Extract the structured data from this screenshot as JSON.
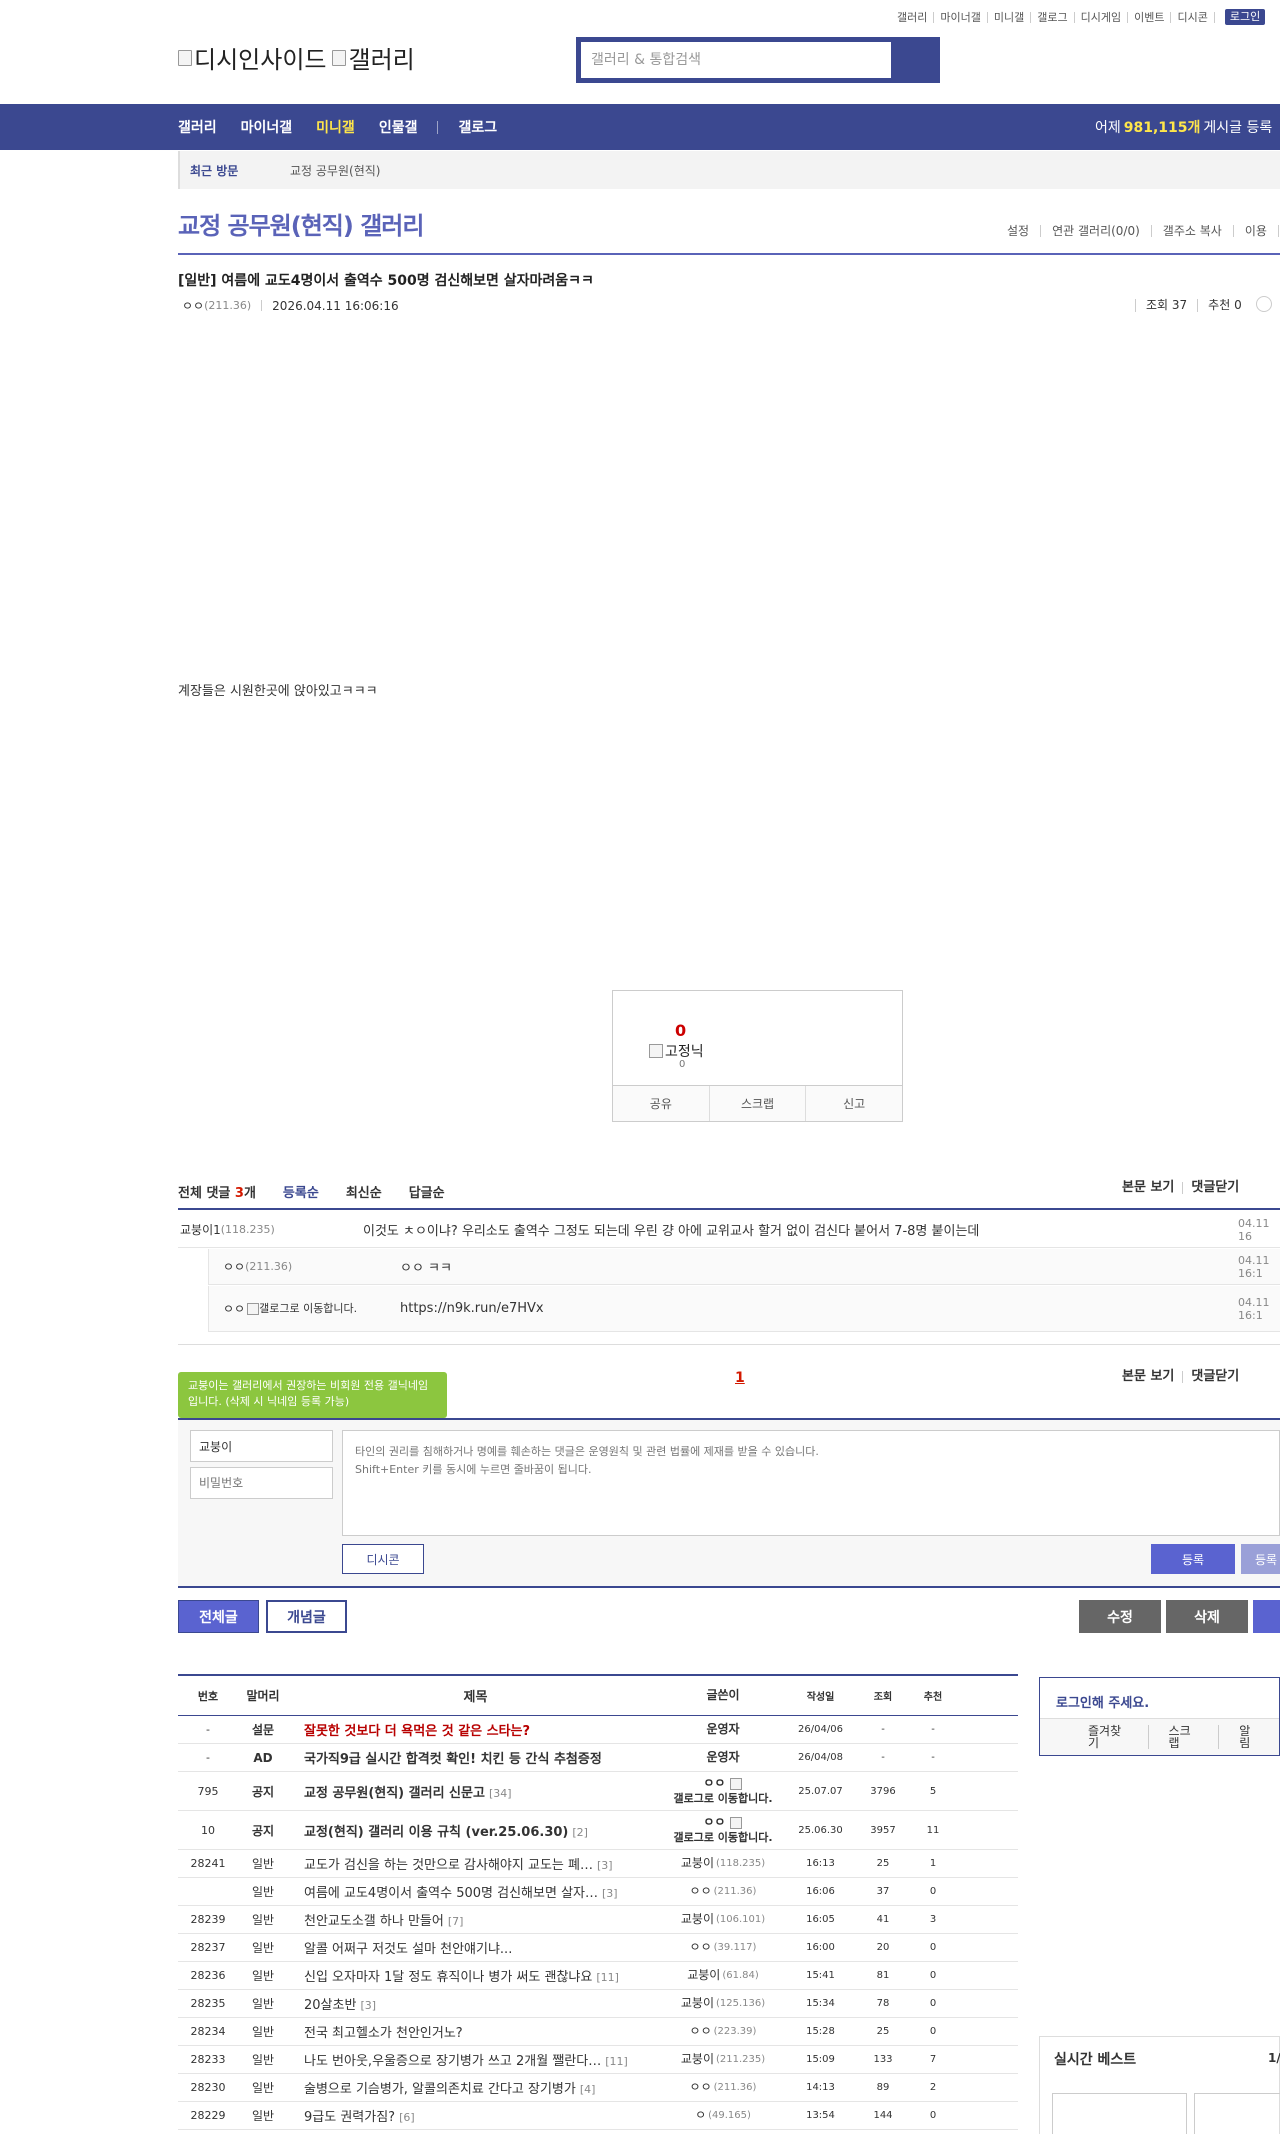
{
  "toplinks": [
    "갤러리",
    "마이너갤",
    "미니갤",
    "갤로그",
    "디시게임",
    "이벤트",
    "디시콘"
  ],
  "login_label": "로그인",
  "logo": {
    "alt1": "디시인사이드",
    "alt2": "갤러리"
  },
  "search": {
    "placeholder": "갤러리 & 통합검색"
  },
  "nav": {
    "items": [
      "갤러리",
      "마이너갤",
      "미니갤",
      "인물갤"
    ],
    "gallog": "갤로그",
    "count_prefix": "어제",
    "count_value": "981,115개",
    "count_suffix": "게시글 등록"
  },
  "recent": {
    "label": "최근 방문",
    "gallery": "교정 공무원(현직)"
  },
  "gallery": {
    "title": "교정 공무원(현직) 갤러리",
    "tools": [
      "설정",
      "연관 갤러리(0/0)",
      "갤주소 복사",
      "이용"
    ]
  },
  "post": {
    "title": "[일반] 여름에 교도4명이서 출역수 500명 검신해보면 살자마려움ㅋㅋ",
    "writer": "ㅇㅇ",
    "writer_ip": "(211.36)",
    "date": "2026.04.11 16:06:16",
    "views_label": "조회 37",
    "recommend_label": "추천 0",
    "body": "계장들은 시원한곳에 앉아있고ㅋㅋㅋ"
  },
  "vote": {
    "count": "0",
    "fixed_nick": "고정닉",
    "fixed_count": "0",
    "share": "공유",
    "scrap": "스크랩",
    "report": "신고"
  },
  "comments": {
    "total_label": "전체 댓글",
    "total_count": "3",
    "total_unit": "개",
    "sorts": [
      "등록순",
      "최신순",
      "답글순"
    ],
    "right_links": [
      "본문 보기",
      "댓글닫기"
    ],
    "items": [
      {
        "nick": "교붕이",
        "num": "1",
        "ip": "(118.235)",
        "text": "이것도 ㅊㅇ이냐? 우리소도 출역수 그정도 되는데 우린 걍 아에 교위교사 할거 없이 검신다 붙어서 7-8명 붙이는데",
        "date": "04.11 16"
      },
      {
        "nick": "ㅇㅇ",
        "ip": "(211.36)",
        "text": "ㅇㅇ ㅋㅋ",
        "date": "04.11 16:1"
      },
      {
        "nick": "ㅇㅇ",
        "ip_alt": "갤로그로 이동합니다.",
        "text": "https://n9k.run/e7HVx",
        "date": "04.11 16:1"
      }
    ],
    "page": "1"
  },
  "tooltip": "교붕이는 갤러리에서 권장하는 비회원 전용 갤닉네임입니다. (삭제 시 닉네임 등록 가능)",
  "write": {
    "nick_value": "교붕이",
    "pw_placeholder": "비밀번호",
    "textarea_placeholder": "타인의 권리를 침해하거나 명예를 훼손하는 댓글은 운영원칙 및 관련 법률에 제재를 받을 수 있습니다.\nShift+Enter 키를 동시에 누르면 줄바꿈이 됩니다.",
    "dccon": "디시콘",
    "register": "등록",
    "register2": "등록"
  },
  "buttons": {
    "all": "전체글",
    "concept": "개념글",
    "edit": "수정",
    "delete": "삭제"
  },
  "list": {
    "headers": [
      "번호",
      "말머리",
      "제목",
      "글쓴이",
      "작성일",
      "조회",
      "추천"
    ],
    "rows": [
      {
        "no": "-",
        "tag": "설문",
        "title": "잘못한 것보다 더 욕먹은 것 같은 스타는?",
        "writer": "운영자",
        "date": "26/04/06",
        "views": "-",
        "rec": "-",
        "style": "bold red"
      },
      {
        "no": "-",
        "tag": "AD",
        "title": "국가직9급 실시간 합격컷 확인! 치킨 등 간식 추첨증정",
        "writer": "운영자",
        "date": "26/04/08",
        "views": "-",
        "rec": "-",
        "style": "bold"
      },
      {
        "no": "795",
        "tag": "공지",
        "title": "교정 공무원(현직) 갤러리 신문고",
        "reply": "[34]",
        "writer": "ㅇㅇ",
        "writer_icon": "갤로그로 이동합니다.",
        "date": "25.07.07",
        "views": "3796",
        "rec": "5",
        "style": "bold tall"
      },
      {
        "no": "10",
        "tag": "공지",
        "title": "교정(현직) 갤러리 이용 규칙 (ver.25.06.30)",
        "reply": "[2]",
        "writer": "ㅇㅇ",
        "writer_icon": "갤로그로 이동합니다.",
        "date": "25.06.30",
        "views": "3957",
        "rec": "11",
        "style": "bold tall"
      },
      {
        "no": "28241",
        "tag": "일반",
        "title": "교도가 검신을 하는 것만으로 감사해야지 교도는 폐…",
        "reply": "[3]",
        "writer": "교붕이",
        "ip": "(118.235)",
        "date": "16:13",
        "views": "25",
        "rec": "1",
        "style": ""
      },
      {
        "no": "",
        "tag": "일반",
        "title": "여름에 교도4명이서 출역수 500명 검신해보면 살자…",
        "reply": "[3]",
        "writer": "ㅇㅇ",
        "ip": "(211.36)",
        "date": "16:06",
        "views": "37",
        "rec": "0",
        "style": ""
      },
      {
        "no": "28239",
        "tag": "일반",
        "title": "천안교도소갤 하나 만들어",
        "reply": "[7]",
        "writer": "교붕이",
        "ip": "(106.101)",
        "date": "16:05",
        "views": "41",
        "rec": "3",
        "style": ""
      },
      {
        "no": "28237",
        "tag": "일반",
        "title": "알콜 어쩌구 저것도 설마 천안얘기냐...",
        "reply": "",
        "writer": "ㅇㅇ",
        "ip": "(39.117)",
        "date": "16:00",
        "views": "20",
        "rec": "0",
        "style": ""
      },
      {
        "no": "28236",
        "tag": "일반",
        "title": "신입 오자마자 1달 정도 휴직이나 병가 써도 괜찮냐요",
        "reply": "[11]",
        "writer": "교붕이",
        "ip": "(61.84)",
        "date": "15:41",
        "views": "81",
        "rec": "0",
        "style": ""
      },
      {
        "no": "28235",
        "tag": "일반",
        "title": "20살초반",
        "reply": "[3]",
        "writer": "교붕이",
        "ip": "(125.136)",
        "date": "15:34",
        "views": "78",
        "rec": "0",
        "style": ""
      },
      {
        "no": "28234",
        "tag": "일반",
        "title": "전국 최고헬소가 천안인거노?",
        "reply": "",
        "writer": "ㅇㅇ",
        "ip": "(223.39)",
        "date": "15:28",
        "views": "25",
        "rec": "0",
        "style": ""
      },
      {
        "no": "28233",
        "tag": "일반",
        "title": "나도 번아웃,우울증으로 장기병가 쓰고 2개월 쨀란다…",
        "reply": "[11]",
        "writer": "교붕이",
        "ip": "(211.235)",
        "date": "15:09",
        "views": "133",
        "rec": "7",
        "style": ""
      },
      {
        "no": "28230",
        "tag": "일반",
        "title": "술병으로 기슴병가, 알콜의존치료 간다고 장기병가",
        "reply": "[4]",
        "writer": "ㅇㅇ",
        "ip": "(211.36)",
        "date": "14:13",
        "views": "89",
        "rec": "2",
        "style": ""
      },
      {
        "no": "28229",
        "tag": "일반",
        "title": "9급도 권력가짐?",
        "reply": "[6]",
        "writer": "ㅇ",
        "ip": "(49.165)",
        "date": "13:54",
        "views": "144",
        "rec": "0",
        "style": ""
      }
    ]
  },
  "side": {
    "login_title": "로그인해 주세요.",
    "login_links": [
      "즐겨찾기",
      "스크랩",
      "알림"
    ],
    "best_title": "실시간 베스트",
    "best_page": "1/"
  }
}
